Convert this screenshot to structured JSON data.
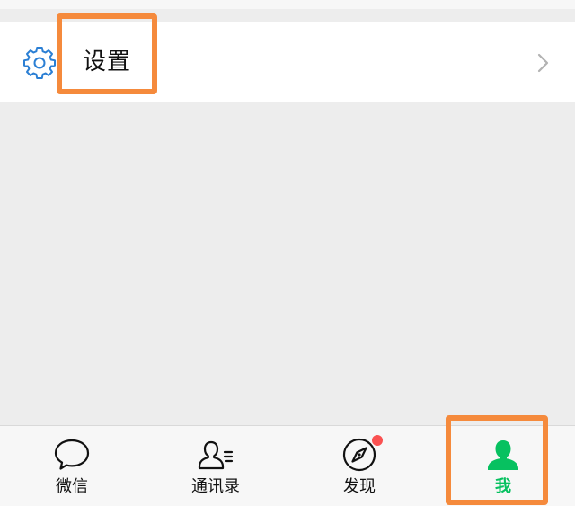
{
  "settings_row": {
    "icon": "gear-icon",
    "label": "设置",
    "chevron": "chevron-right-icon"
  },
  "tabbar": {
    "tabs": [
      {
        "label": "微信",
        "icon": "chat-bubble-icon",
        "active": false
      },
      {
        "label": "通讯录",
        "icon": "contacts-icon",
        "active": false
      },
      {
        "label": "发现",
        "icon": "compass-icon",
        "active": false,
        "badge": "red-dot"
      },
      {
        "label": "我",
        "icon": "person-icon",
        "active": true
      }
    ]
  },
  "colors": {
    "accent_green": "#07c160",
    "highlight_orange": "#f58a3c",
    "badge_red": "#fa5151",
    "settings_icon_blue": "#2b7fd4"
  }
}
